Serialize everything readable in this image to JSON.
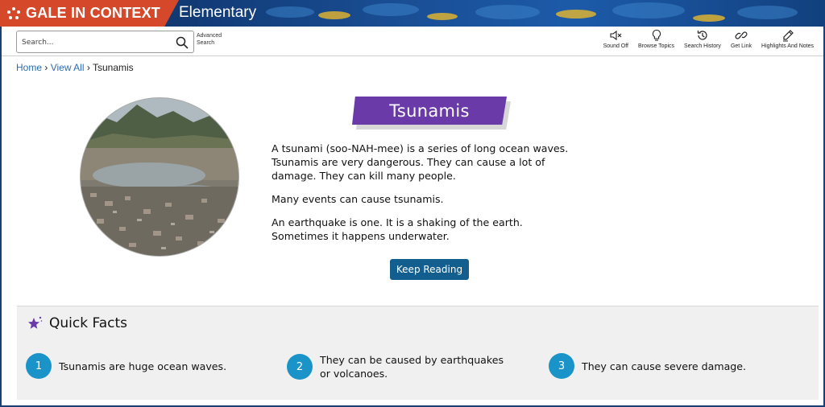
{
  "header": {
    "brand": "GALE IN CONTEXT",
    "product": "Elementary"
  },
  "toolbar": {
    "search_placeholder": "Search...",
    "advanced_search_line1": "Advanced",
    "advanced_search_line2": "Search",
    "tools": [
      {
        "label": "Sound Off",
        "icon": "sound-off-icon"
      },
      {
        "label": "Browse Topics",
        "icon": "lightbulb-icon"
      },
      {
        "label": "Search History",
        "icon": "history-icon"
      },
      {
        "label": "Get Link",
        "icon": "link-icon"
      },
      {
        "label": "Highlights And Notes",
        "icon": "pencil-icon"
      }
    ]
  },
  "breadcrumb": {
    "home": "Home",
    "view_all": "View All",
    "current": "Tsunamis"
  },
  "article": {
    "title": "Tsunamis",
    "paragraphs": [
      "A tsunami (soo-NAH-mee) is a series of long ocean waves. Tsunamis are very dangerous. They can cause a lot of damage. They can kill many people.",
      "Many events can cause tsunamis.",
      "An earthquake is one. It is a shaking of the earth. Sometimes it happens underwater."
    ],
    "keep_reading": "Keep Reading"
  },
  "quick_facts": {
    "heading": "Quick Facts",
    "facts": [
      {
        "number": "1",
        "text": "Tsunamis are huge ocean waves."
      },
      {
        "number": "2",
        "text": "They can be caused by earthquakes or volcanoes."
      },
      {
        "number": "3",
        "text": "They can cause severe damage."
      }
    ]
  },
  "colors": {
    "brand_red": "#d5482a",
    "title_purple": "#6a3aa8",
    "button_blue": "#125f8f",
    "fact_blue": "#1a93c8"
  }
}
